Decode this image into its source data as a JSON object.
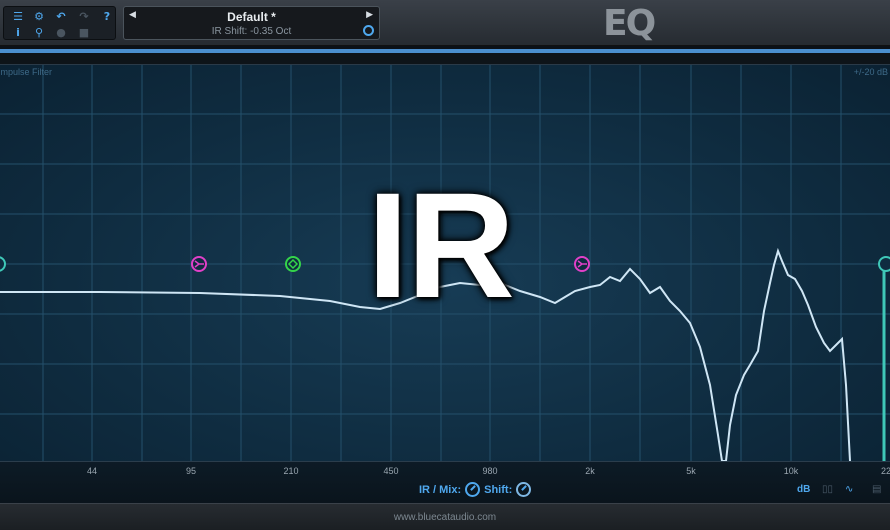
{
  "toolbar": {
    "icons": [
      "menu-icon",
      "gear-icon",
      "undo-icon",
      "redo-icon",
      "help-icon",
      "info-icon",
      "zoom-icon",
      "record-icon",
      "lock-icon"
    ]
  },
  "preset": {
    "name": "Default *",
    "subtitle": "IR Shift: -0.35 Oct"
  },
  "logo": "EQ",
  "graph": {
    "title": "Impulse Filter",
    "range": "+/-20 dB",
    "overlay_text": "IR",
    "colors": {
      "curve": "#cfe6f5",
      "handle_magenta": "#e040c8",
      "handle_green": "#34d44a",
      "handle_teal": "#3fc8b8"
    }
  },
  "axis": {
    "ticks": [
      "44",
      "95",
      "210",
      "450",
      "980",
      "2k",
      "5k",
      "10k",
      "22"
    ],
    "ir_label": "IR",
    "mix_label": "/ Mix:",
    "shift_label": "Shift:",
    "db_label": "dB"
  },
  "footer": {
    "url": "www.bluecataudio.com"
  }
}
